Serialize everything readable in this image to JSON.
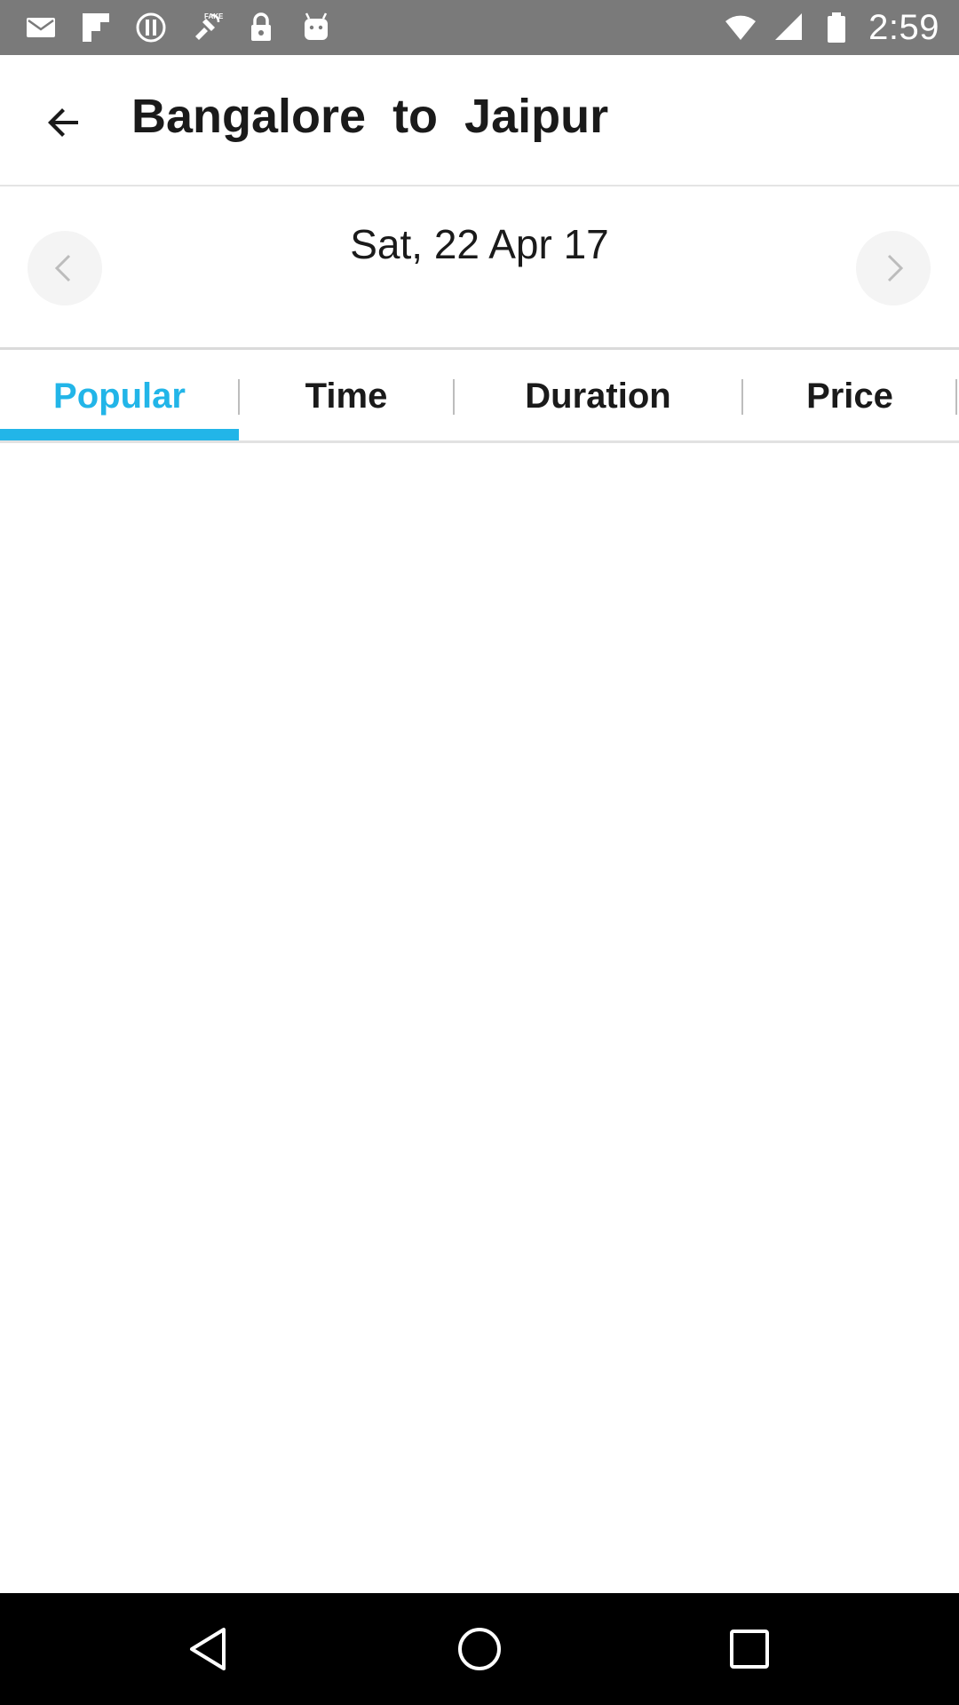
{
  "status_bar": {
    "time": "2:59",
    "left_icons": [
      "mail-icon",
      "flipboard-icon",
      "sync-icon",
      "fake-gps-icon",
      "lock-icon",
      "android-icon"
    ],
    "right_icons": [
      "wifi-icon",
      "cellular-signal-icon",
      "battery-icon"
    ]
  },
  "app_bar": {
    "title": "Bangalore  to  Jaipur",
    "back_icon": "arrow-left-icon"
  },
  "date_selector": {
    "date": "Sat, 22 Apr 17",
    "prev_icon": "chevron-left-icon",
    "next_icon": "chevron-right-icon"
  },
  "sort_tabs": {
    "selected": "Popular",
    "tabs": [
      {
        "label": "Popular"
      },
      {
        "label": "Time"
      },
      {
        "label": "Duration"
      },
      {
        "label": "Price"
      }
    ]
  },
  "navigation_bar": {
    "buttons": [
      "back-triangle-icon",
      "home-circle-icon",
      "recents-square-icon"
    ]
  },
  "colors": {
    "accent": "#22b5e8",
    "status_bar": "#7a7a7a",
    "nav_bar": "#000000",
    "text": "#1a1a1a"
  }
}
